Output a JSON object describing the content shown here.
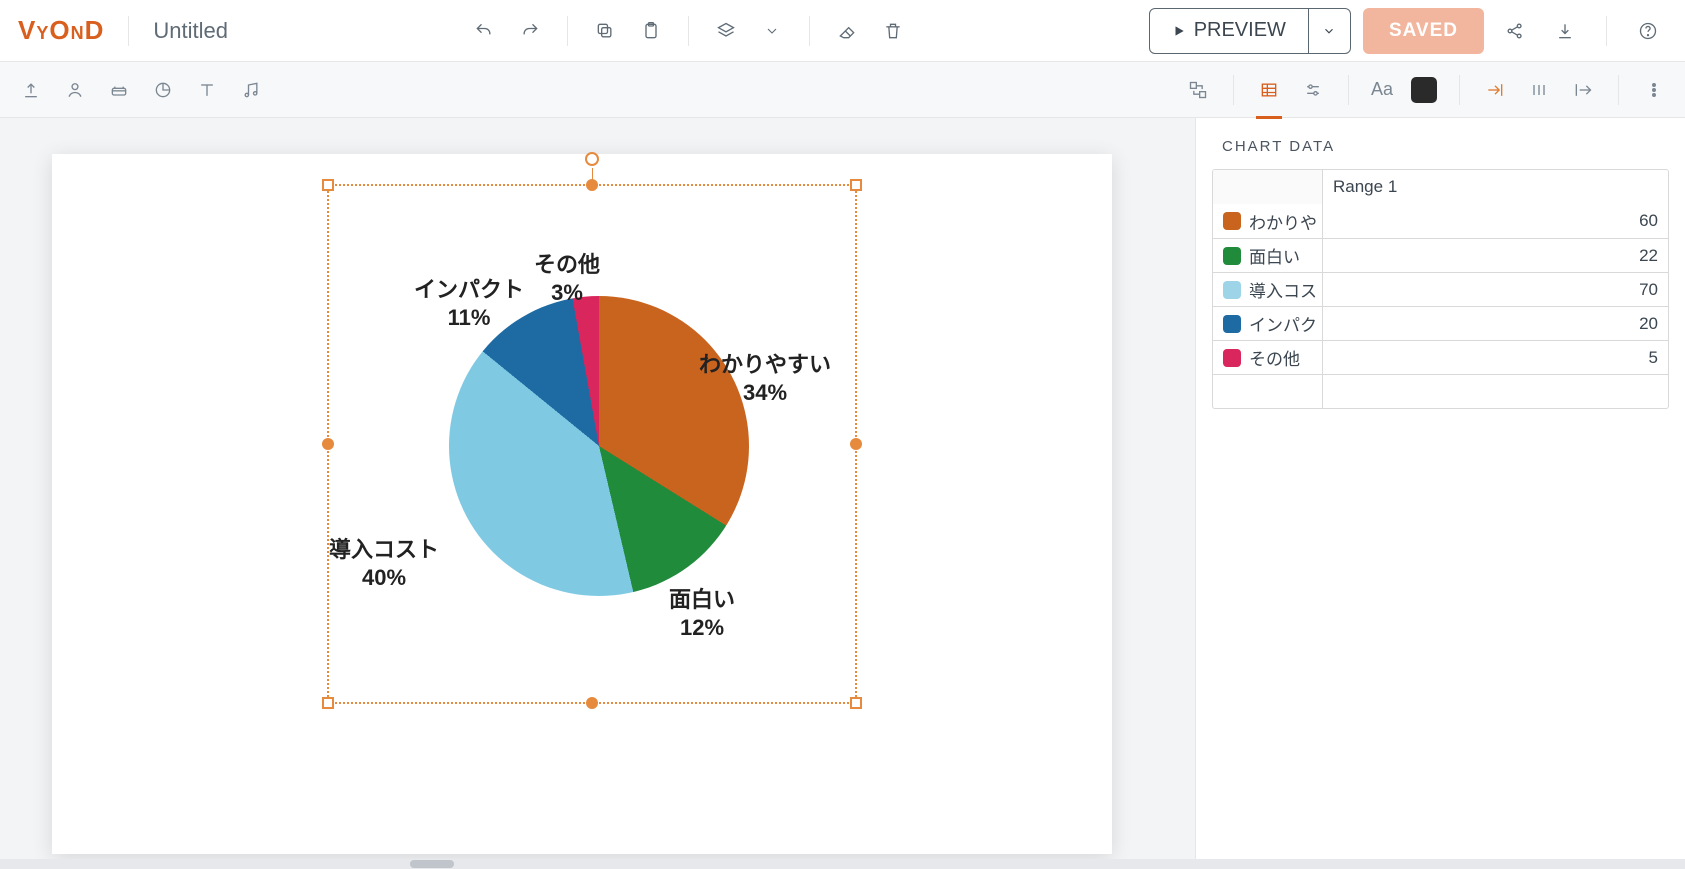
{
  "app": {
    "logo": "VYOND",
    "title": "Untitled"
  },
  "toolbar": {
    "preview": "PREVIEW",
    "saved": "SAVED"
  },
  "panel": {
    "title": "CHART DATA",
    "range_label": "Range 1",
    "rows": [
      {
        "label": "わかりや",
        "color": "#c9641f",
        "value": "60"
      },
      {
        "label": "面白い",
        "color": "#1f8b3b",
        "value": "22"
      },
      {
        "label": "導入コス",
        "color": "#9ed4e8",
        "value": "70"
      },
      {
        "label": "インパク",
        "color": "#1e6aa3",
        "value": "20"
      },
      {
        "label": "その他",
        "color": "#d9265c",
        "value": "5"
      }
    ]
  },
  "chart_data": {
    "type": "pie",
    "categories": [
      "わかりやすい",
      "面白い",
      "導入コスト",
      "インパクト",
      "その他"
    ],
    "values": [
      60,
      22,
      70,
      20,
      5
    ],
    "percent_labels": [
      "34%",
      "12%",
      "40%",
      "11%",
      "3%"
    ],
    "colors": [
      "#c9641f",
      "#1f8b3b",
      "#7fc9e3",
      "#1e6aa3",
      "#d9265c"
    ],
    "labels": {
      "l0": "わかりやすい",
      "p0": "34%",
      "l1": "面白い",
      "p1": "12%",
      "l2": "導入コスト",
      "p2": "40%",
      "l3": "インパクト",
      "p3": "11%",
      "l4": "その他",
      "p4": "3%"
    }
  }
}
